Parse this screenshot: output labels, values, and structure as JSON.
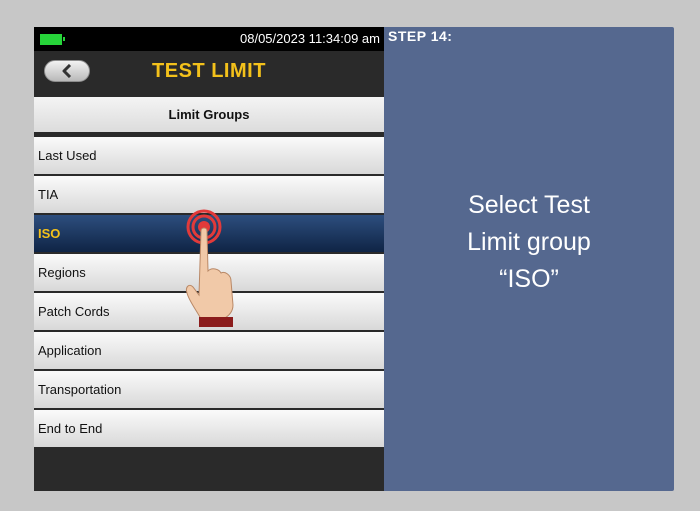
{
  "device": {
    "status": {
      "datetime": "08/05/2023 11:34:09 am"
    },
    "title": "TEST LIMIT",
    "list_header": "Limit Groups",
    "items": [
      {
        "label": "Last Used"
      },
      {
        "label": "TIA"
      },
      {
        "label": "ISO"
      },
      {
        "label": "Regions"
      },
      {
        "label": "Patch Cords"
      },
      {
        "label": "Application"
      },
      {
        "label": "Transportation"
      },
      {
        "label": "End to End"
      }
    ],
    "selected_item": "ISO"
  },
  "instructions": {
    "step": "STEP 14:",
    "text_line1": "Select Test",
    "text_line2": "Limit group",
    "text_line3": "“ISO”"
  },
  "colors": {
    "title": "#f3c11b",
    "panel": "#55688f",
    "selected_row": "#1c355d",
    "battery": "#27d43a"
  }
}
